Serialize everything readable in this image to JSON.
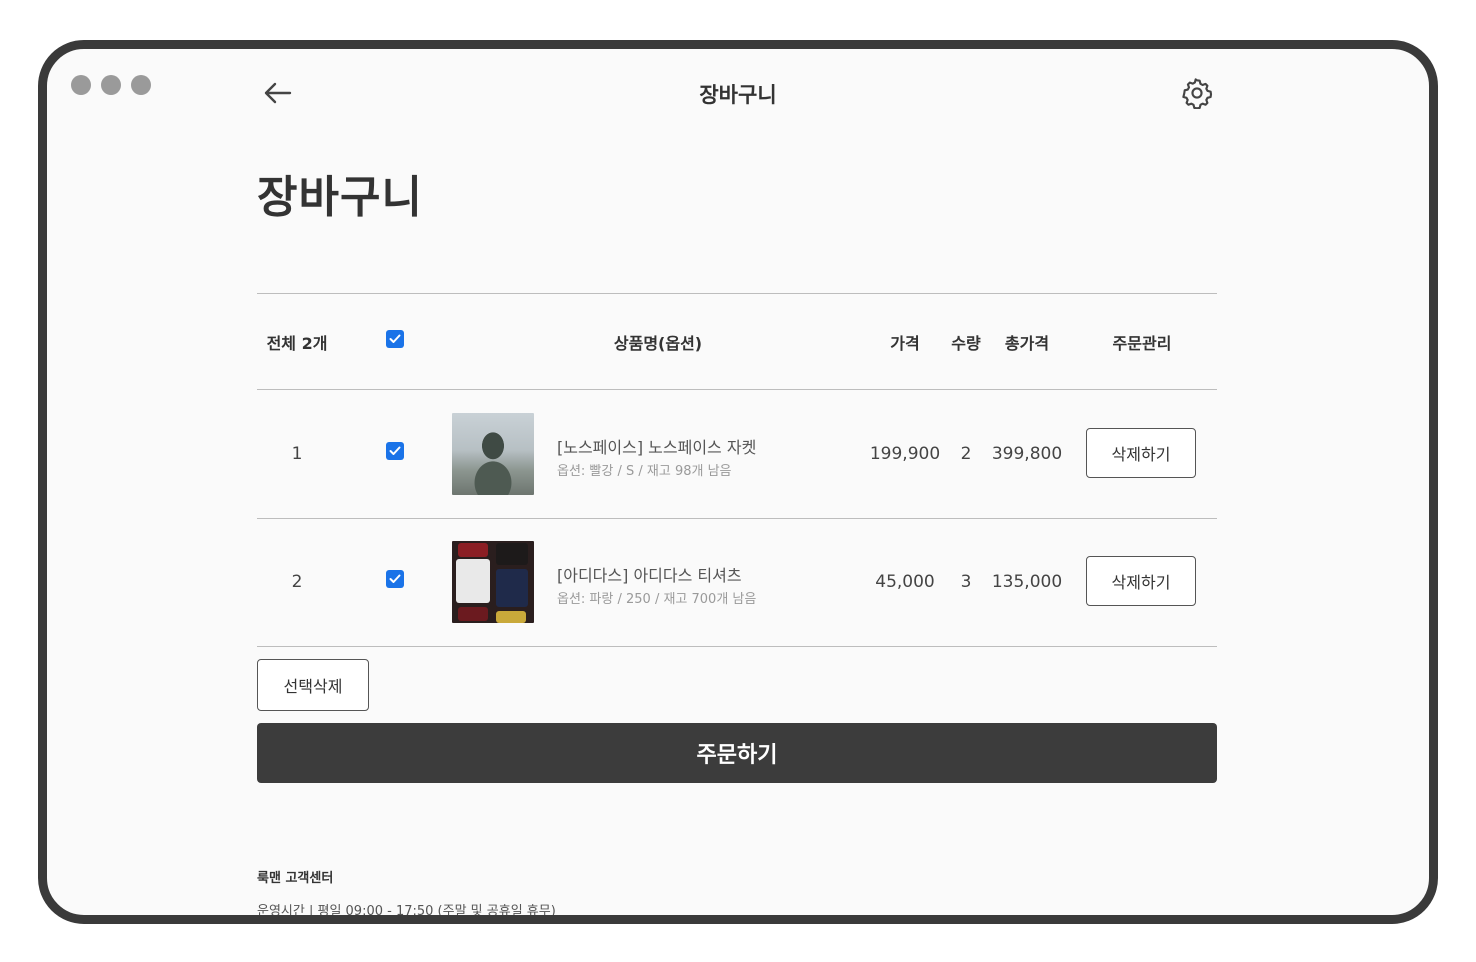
{
  "header": {
    "title": "장바구니"
  },
  "page": {
    "heading": "장바구니"
  },
  "table": {
    "columns": {
      "count": "전체 2개",
      "product": "상품명(옵션)",
      "price": "가격",
      "qty": "수량",
      "total": "총가격",
      "manage": "주문관리"
    },
    "all_checked": true,
    "rows": [
      {
        "index": "1",
        "checked": true,
        "name": "[노스페이스] 노스페이스 자켓",
        "option": "옵션: 빨강 / S / 재고 98개 남음",
        "price": "199,900",
        "qty": "2",
        "total": "399,800",
        "delete_label": "삭제하기"
      },
      {
        "index": "2",
        "checked": true,
        "name": "[아디다스] 아디다스 티셔츠",
        "option": "옵션: 파랑 / 250 / 재고 700개 남음",
        "price": "45,000",
        "qty": "3",
        "total": "135,000",
        "delete_label": "삭제하기"
      }
    ]
  },
  "actions": {
    "select_delete": "선택삭제",
    "order": "주문하기"
  },
  "footer": {
    "title": "룩맨 고객센터",
    "hours": "운영시간 | 평일 09:00 - 17:50 (주말 및 공휴일 휴무)"
  },
  "colors": {
    "accent": "#1a73e8",
    "order_button": "#3c3c3c",
    "frame": "#3a3a3a"
  },
  "icons": [
    "back-arrow-icon",
    "gear-icon",
    "checkmark-icon"
  ]
}
